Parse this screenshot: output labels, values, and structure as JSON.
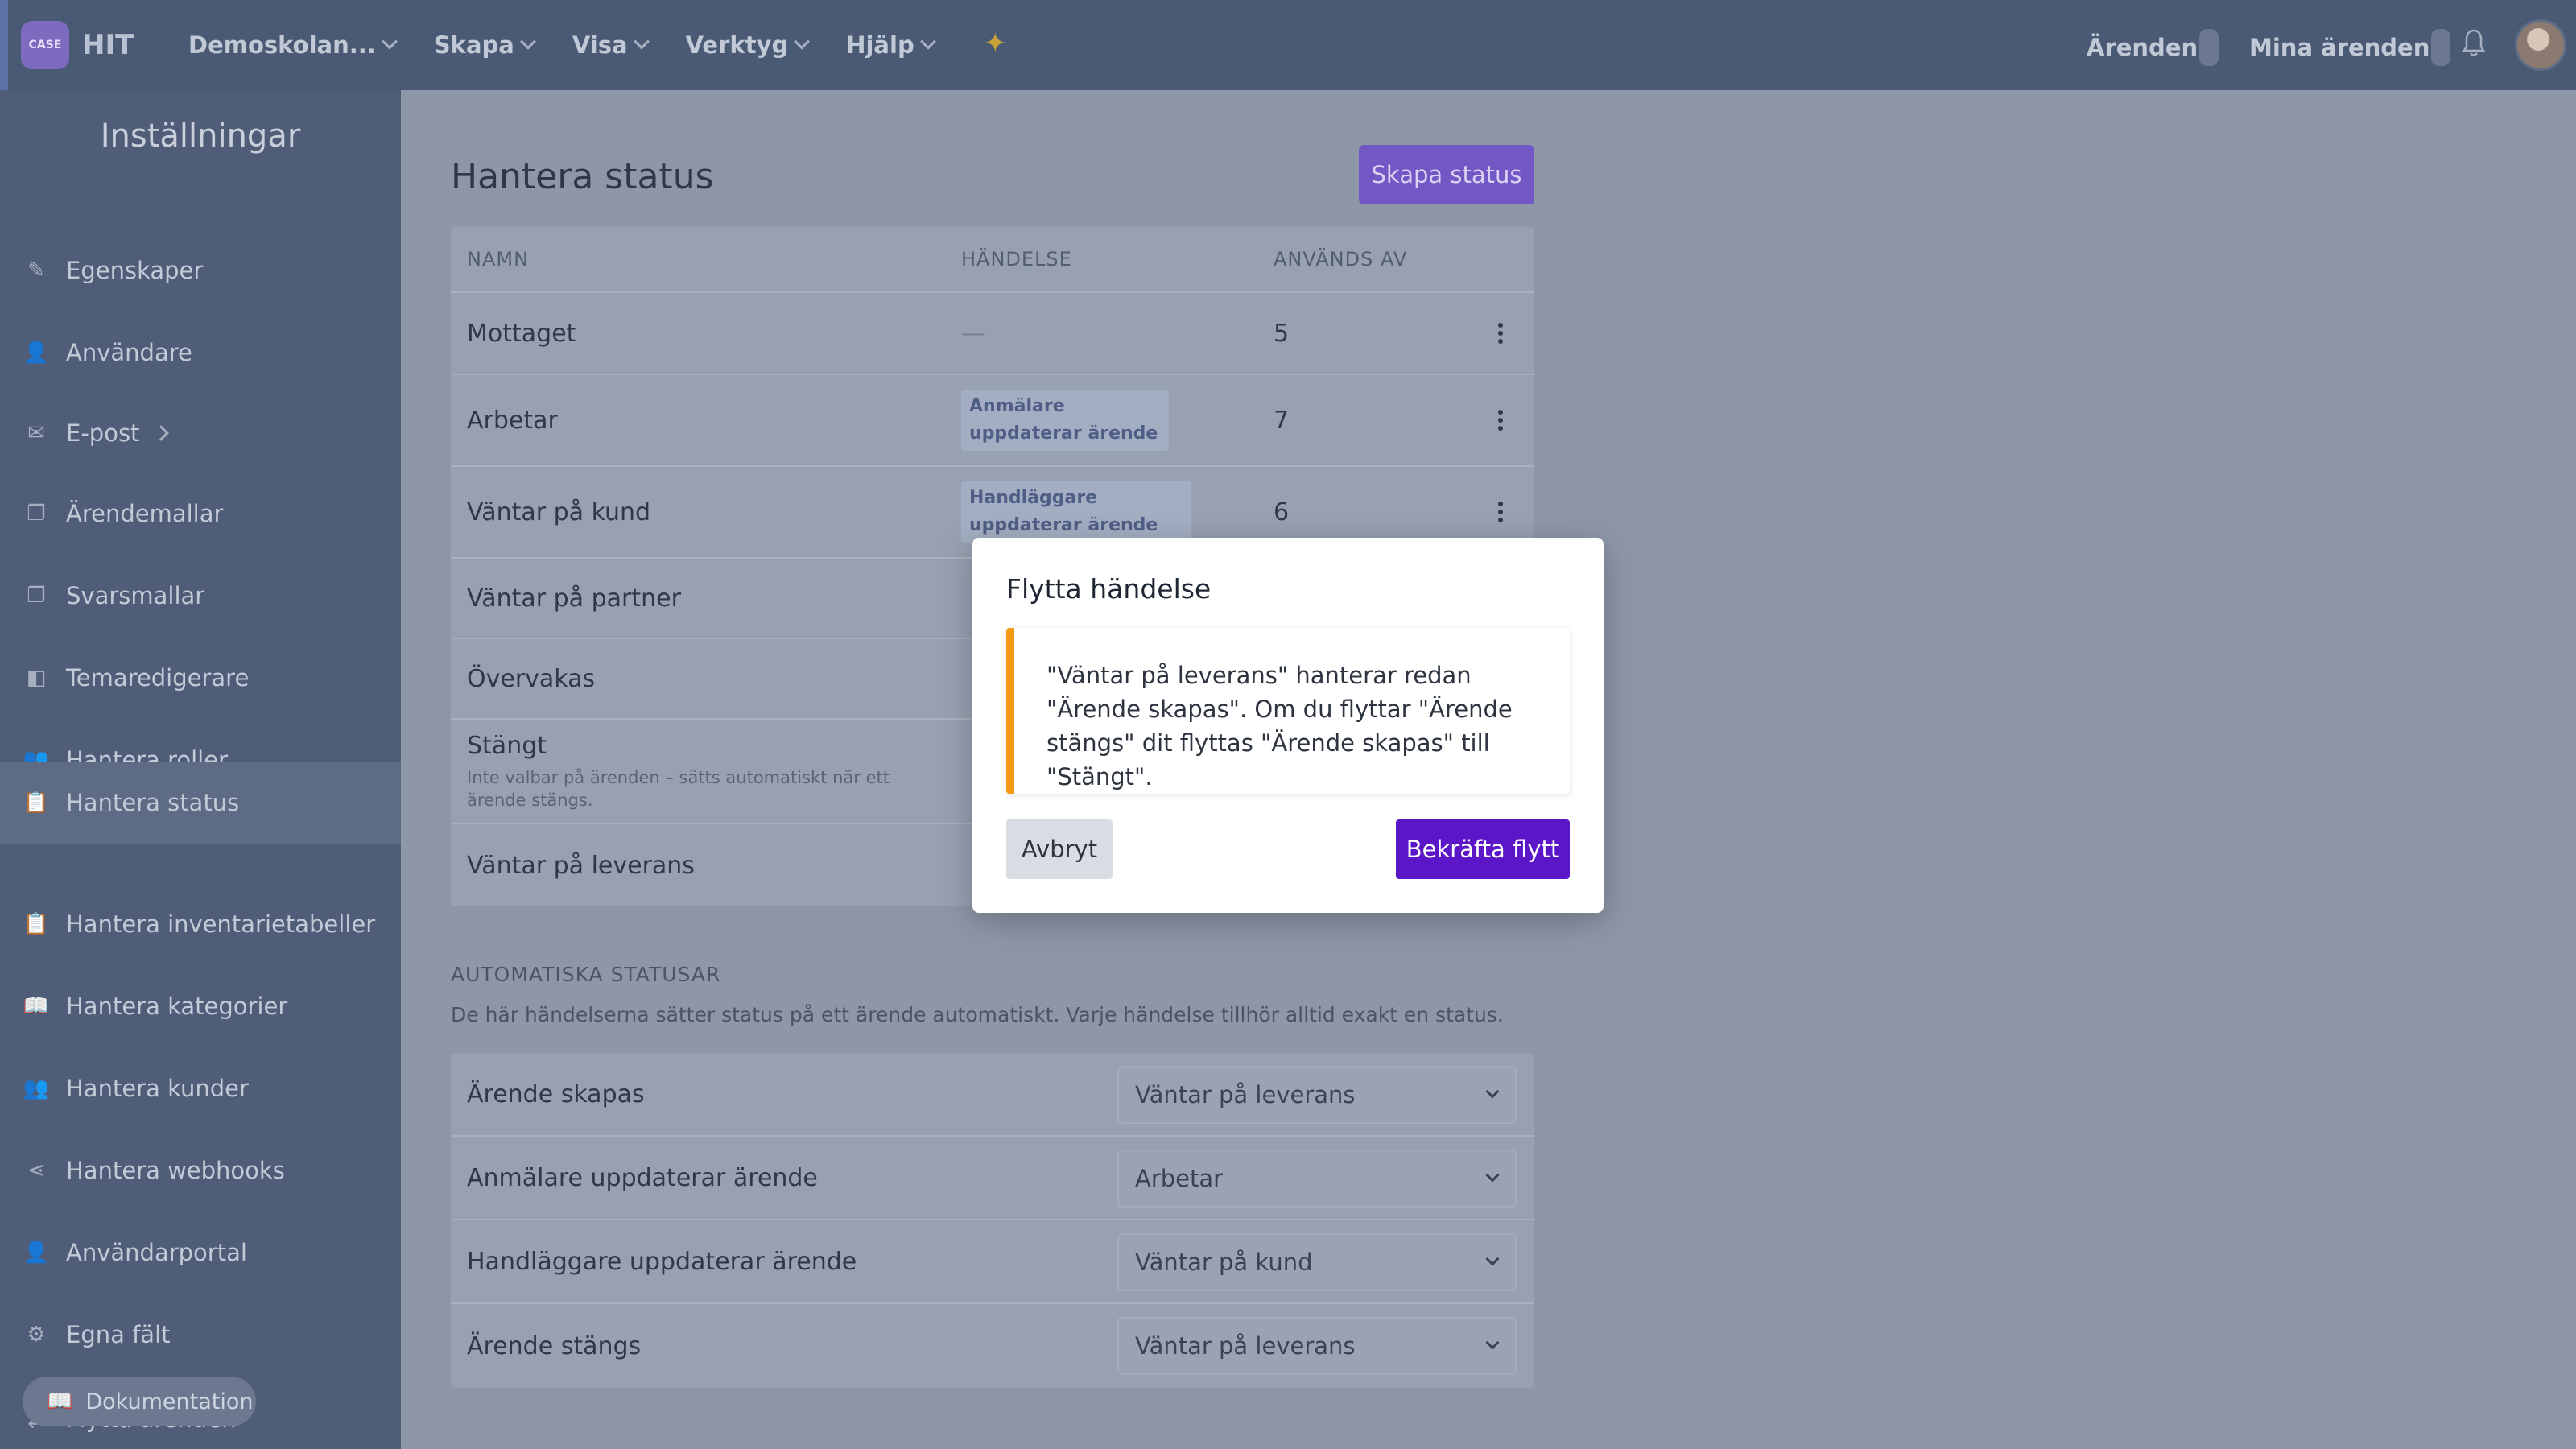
{
  "app": {
    "name": "HIT",
    "logo_text": "CASE"
  },
  "nav": {
    "items": [
      {
        "label": "Demoskolan..."
      },
      {
        "label": "Skapa"
      },
      {
        "label": "Visa"
      },
      {
        "label": "Verktyg"
      },
      {
        "label": "Hjälp"
      }
    ],
    "right": {
      "arenden": "Ärenden",
      "mina_arenden": "Mina ärenden"
    }
  },
  "sidebar": {
    "title": "Inställningar",
    "items": [
      {
        "label": "Egenskaper",
        "icon": "pencil-icon"
      },
      {
        "label": "Användare",
        "icon": "user-icon"
      },
      {
        "label": "E-post",
        "icon": "mail-icon"
      },
      {
        "label": "Ärendemallar",
        "icon": "copy-icon"
      },
      {
        "label": "Svarsmallar",
        "icon": "copy-icon"
      },
      {
        "label": "Temaredigerare",
        "icon": "theme-icon"
      },
      {
        "label": "Hantera roller",
        "icon": "users-icon"
      },
      {
        "label": "Hantera status",
        "icon": "clipboard-icon"
      },
      {
        "label": "Hantera inventarietabeller",
        "icon": "clipboard-icon"
      },
      {
        "label": "Hantera kategorier",
        "icon": "book-icon"
      },
      {
        "label": "Hantera kunder",
        "icon": "users-icon"
      },
      {
        "label": "Hantera webhooks",
        "icon": "share-icon"
      },
      {
        "label": "Användarportal",
        "icon": "user-icon"
      },
      {
        "label": "Egna fält",
        "icon": "gear-icon"
      },
      {
        "label": "Flytta ärenden",
        "icon": "move-icon"
      }
    ],
    "doc_button": "Dokumentation"
  },
  "main": {
    "title": "Hantera status",
    "create_button": "Skapa status",
    "table": {
      "headers": {
        "name": "NAMN",
        "event": "HÄNDELSE",
        "used_by": "ANVÄNDS AV"
      },
      "rows": [
        {
          "name": "Mottaget",
          "event": "—",
          "used_by": "5"
        },
        {
          "name": "Arbetar",
          "event": "Anmälare uppdaterar ärende",
          "used_by": "7"
        },
        {
          "name": "Väntar på kund",
          "event": "Handläggare uppdaterar ärende",
          "used_by": "6"
        },
        {
          "name": "Väntar på partner",
          "event": "",
          "used_by": ""
        },
        {
          "name": "Övervakas",
          "event": "",
          "used_by": ""
        },
        {
          "name": "Stängt",
          "note": "Inte valbar på ärenden – sätts automatiskt när ett ärende stängs.",
          "event": "",
          "used_by": ""
        },
        {
          "name": "Väntar på leverans",
          "event": "",
          "used_by": ""
        }
      ]
    },
    "automatic": {
      "title": "AUTOMATISKA STATUSAR",
      "description": "De här händelserna sätter status på ett ärende automatiskt. Varje händelse tillhör alltid exakt en status.",
      "rows": [
        {
          "event": "Ärende skapas",
          "status": "Väntar på leverans"
        },
        {
          "event": "Anmälare uppdaterar ärende",
          "status": "Arbetar"
        },
        {
          "event": "Handläggare uppdaterar ärende",
          "status": "Väntar på kund"
        },
        {
          "event": "Ärende stängs",
          "status": "Väntar på leverans"
        }
      ]
    }
  },
  "modal": {
    "title": "Flytta händelse",
    "message": "\"Väntar på leverans\" hanterar redan \"Ärende skapas\". Om du flyttar \"Ärende stängs\" dit flyttas \"Ärende skapas\" till \"Stängt\".",
    "cancel": "Avbryt",
    "confirm": "Bekräfta flytt"
  },
  "colors": {
    "accent": "#5b16c7",
    "warning": "#f39c12"
  }
}
